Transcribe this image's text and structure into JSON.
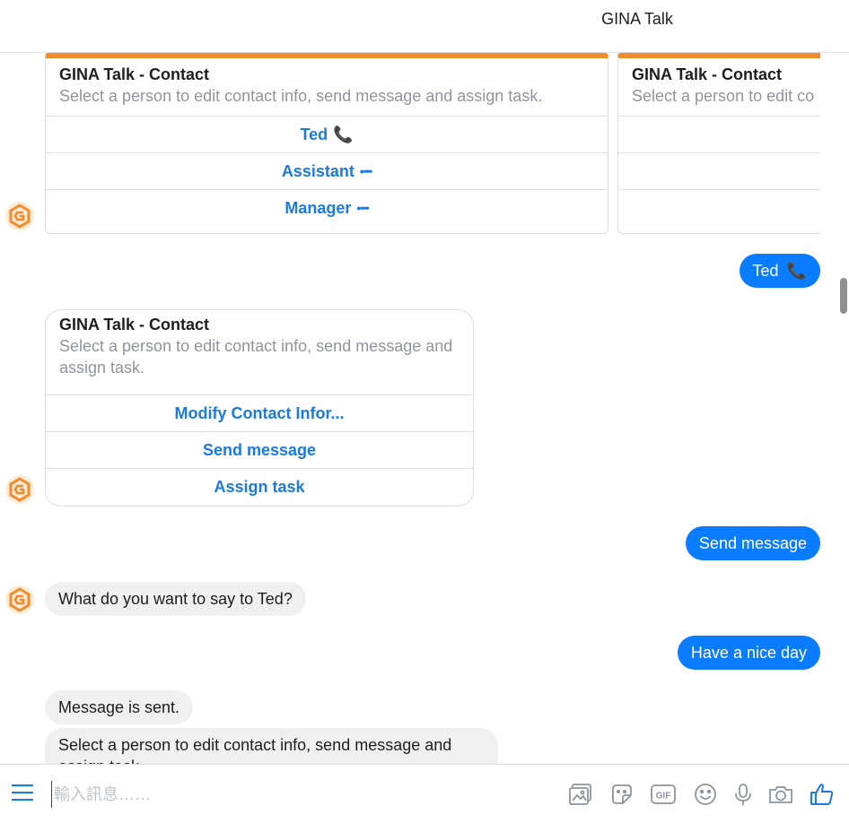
{
  "header": {
    "title": "GINA Talk"
  },
  "cards": {
    "contact_1": {
      "title": "GINA Talk - Contact",
      "subtitle": "Select a person to edit contact info, send message and assign task.",
      "buttons": [
        {
          "label": "Ted",
          "icon": "📞"
        },
        {
          "label": "Assistant",
          "icon": "•━"
        },
        {
          "label": "Manager",
          "icon": "•━"
        }
      ]
    },
    "contact_2": {
      "title": "GINA Talk - Contact",
      "subtitle": "Select a person to edit co"
    },
    "contact_menu": {
      "title": "GINA Talk - Contact",
      "subtitle": "Select a person to edit contact info, send message and assign task.",
      "buttons": [
        {
          "label": "Modify Contact Infor..."
        },
        {
          "label": "Send message"
        },
        {
          "label": "Assign task"
        }
      ]
    }
  },
  "messages": {
    "out_ted": {
      "text": "Ted",
      "icon": "📞"
    },
    "out_send": {
      "text": "Send message"
    },
    "in_question": {
      "text": "What do you want to say to Ted?"
    },
    "out_nice": {
      "text": "Have a nice day"
    },
    "in_sent": {
      "text": "Message is sent."
    },
    "in_select": {
      "text": "Select a person to edit contact info, send message and assign task."
    }
  },
  "composer": {
    "placeholder": "輸入訊息……",
    "tools": [
      "image-icon",
      "sticker-icon",
      "gif-icon",
      "emoji-icon",
      "microphone-icon",
      "camera-icon",
      "like-icon"
    ]
  },
  "colors": {
    "accent": "#0a7cff",
    "link": "#1a7ae0",
    "card_top": "#f28a2e",
    "bubble_in": "#f1f0f0",
    "tool": "#8d949e"
  }
}
